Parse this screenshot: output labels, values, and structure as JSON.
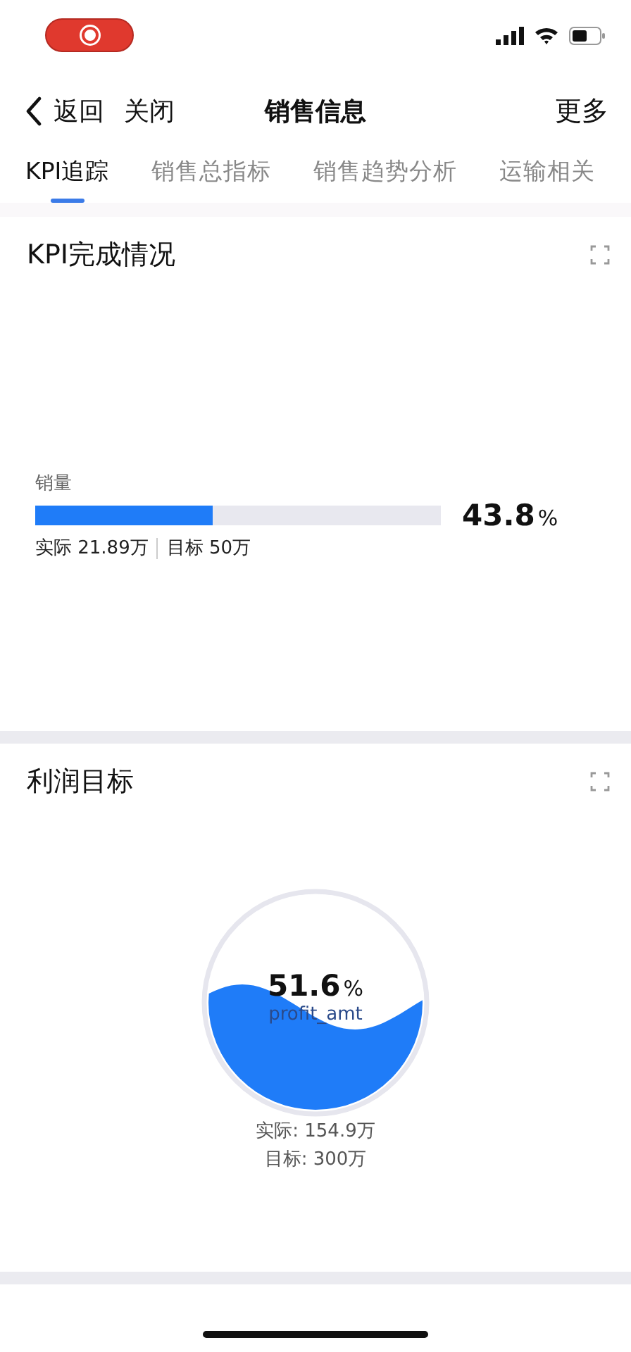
{
  "nav": {
    "back": "返回",
    "close": "关闭",
    "title": "销售信息",
    "more": "更多"
  },
  "tabs": [
    {
      "label": "KPI追踪",
      "selected": true
    },
    {
      "label": "销售总指标",
      "selected": false
    },
    {
      "label": "销售趋势分析",
      "selected": false
    },
    {
      "label": "运输相关",
      "selected": false
    }
  ],
  "cards": [
    {
      "kind": "bar",
      "title": "KPI完成情况",
      "metric": {
        "label": "销量",
        "level": 0.438,
        "percent": "43.8",
        "unit": "%",
        "actual": "实际 21.89万",
        "target": "目标 50万"
      }
    },
    {
      "kind": "liquid",
      "title": "利润目标",
      "metric": {
        "percent": "51.6",
        "unit": "%",
        "field": "profit_amt",
        "actual": "实际: 154.9万",
        "target": "目标: 300万"
      }
    }
  ]
}
